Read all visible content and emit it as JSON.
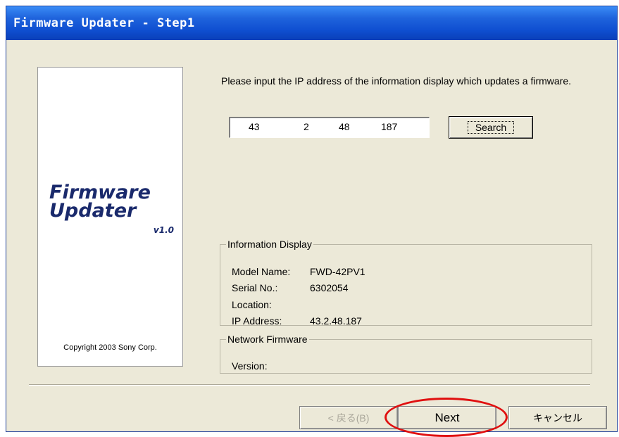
{
  "window": {
    "title": "Firmware Updater - Step1"
  },
  "logo": {
    "line1": "Firmware",
    "line2": "Updater",
    "version": "v1.0",
    "copyright": "Copyright 2003 Sony Corp."
  },
  "prompt": {
    "text": "Please input the IP address of the information display which updates a firmware."
  },
  "ip_address": {
    "octets": [
      "43",
      "2",
      "48",
      "187"
    ]
  },
  "search_button": {
    "label": "Search"
  },
  "info_group": {
    "legend": "Information Display",
    "rows": [
      {
        "label": "Model Name:",
        "value": "FWD-42PV1"
      },
      {
        "label": "Serial No.:",
        "value": "6302054"
      },
      {
        "label": "Location:",
        "value": ""
      },
      {
        "label": "IP Address:",
        "value": "43.2.48.187"
      }
    ]
  },
  "network_group": {
    "legend": "Network Firmware",
    "rows": [
      {
        "label": "Version:",
        "value": ""
      }
    ]
  },
  "footer": {
    "back_label": "< 戻る(B)",
    "next_label": "Next",
    "cancel_label": "キャンセル"
  },
  "colors": {
    "titlebar": "#0f4fd1",
    "dialog_bg": "#ece9d8",
    "logo_text": "#1a2a6c",
    "highlight": "#e01010"
  }
}
